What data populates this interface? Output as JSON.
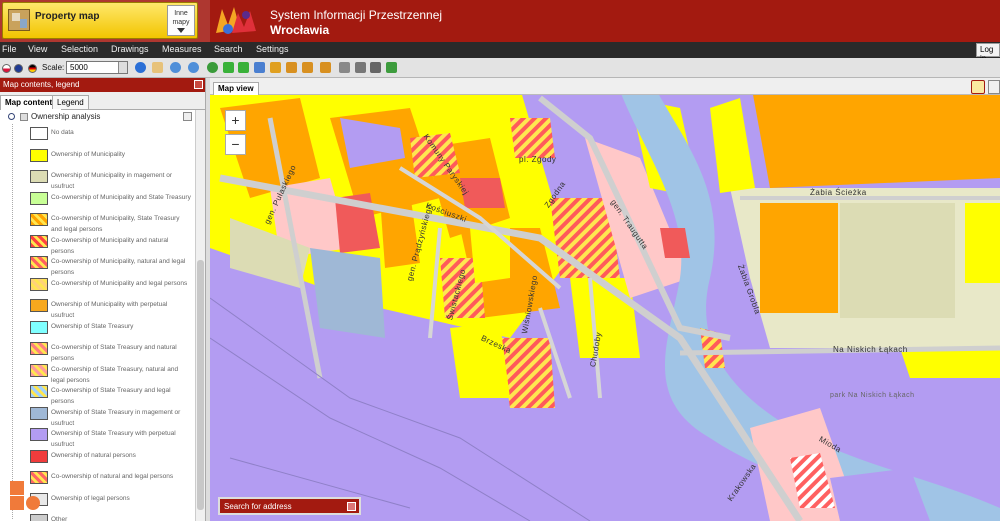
{
  "header": {
    "app_title": "Property map",
    "other_maps_label_line1": "Inne",
    "other_maps_label_line2": "mapy",
    "system_title_line1": "System Informacji Przestrzennej",
    "system_title_line2": "Wrocławia"
  },
  "menu": {
    "items": [
      "File",
      "View",
      "Selection",
      "Drawings",
      "Measures",
      "Search",
      "Settings"
    ],
    "login_label": "Log in"
  },
  "toolbar": {
    "scale_label": "Scale:",
    "scale_value": "5000"
  },
  "panel": {
    "title": "Map contents, legend",
    "tabs": [
      "Map contents",
      "Legend"
    ],
    "layer_name": "Ownership analysis"
  },
  "legend": [
    {
      "label": "No data",
      "color": "#ffffff"
    },
    {
      "label": "Ownership of Municipality",
      "color": "#ffff00"
    },
    {
      "label": "Ownership of Municipality in magement or usufruct",
      "color": "#dcdcb4"
    },
    {
      "label": "Co-ownership of Municipality and State Treasury",
      "color": "#c8ff96"
    },
    {
      "label": "Co-ownership of Municipality, State Treasury and legal persons",
      "color": "#ffa500"
    },
    {
      "label": "Co-ownership of Municipality and natural persons",
      "color": "#ff4040"
    },
    {
      "label": "Co-ownership of Municipality, natural and legal persons",
      "color": "#ff6060"
    },
    {
      "label": "Co-ownership of Municipality and legal persons",
      "color": "#ffd27a"
    },
    {
      "label": "Ownership of Municipality with perpetual usufruct",
      "color": "#f7a81e"
    },
    {
      "label": "Ownership of State Treasury",
      "color": "#7fffff"
    },
    {
      "label": "Co-ownership of State Treasury and natural persons",
      "color": "#ff8080"
    },
    {
      "label": "Co-ownership of State Treasury, natural and legal persons",
      "color": "#ff9b9b"
    },
    {
      "label": "Co-ownership of State Treasury and legal persons",
      "color": "#a0d2ff"
    },
    {
      "label": "Ownership of State Treasury in magement or usufruct",
      "color": "#9fb8d6"
    },
    {
      "label": "Ownership of State Treasury with perpetual usufruct",
      "color": "#b39cf2"
    },
    {
      "label": "Ownership of natural persons",
      "color": "#f03c3c"
    },
    {
      "label": "Co-ownership of natural and legal persons",
      "color": "#ff6666"
    },
    {
      "label": "Ownership of legal persons",
      "color": "#e8e8e8"
    },
    {
      "label": "Other",
      "color": "#cccccc"
    }
  ],
  "map": {
    "tab_label": "Map view",
    "zoom_in": "+",
    "zoom_out": "−",
    "search_label": "Search for address",
    "streets": [
      "gen. Pułaskiego",
      "Kościuszki",
      "pl. Zgody",
      "Zgodna",
      "gen. Traugutta",
      "Żabia Ścieżka",
      "Żabia Grobla",
      "Na Niskich Łąkach",
      "park Na Niskich Łąkach",
      "Mioda",
      "Krakowska",
      "Świstackiego",
      "Brzeska",
      "Wiśniowskiego",
      "Chudoby",
      "Komuny Paryskiej",
      "gen. Prądzyńskiego"
    ]
  }
}
